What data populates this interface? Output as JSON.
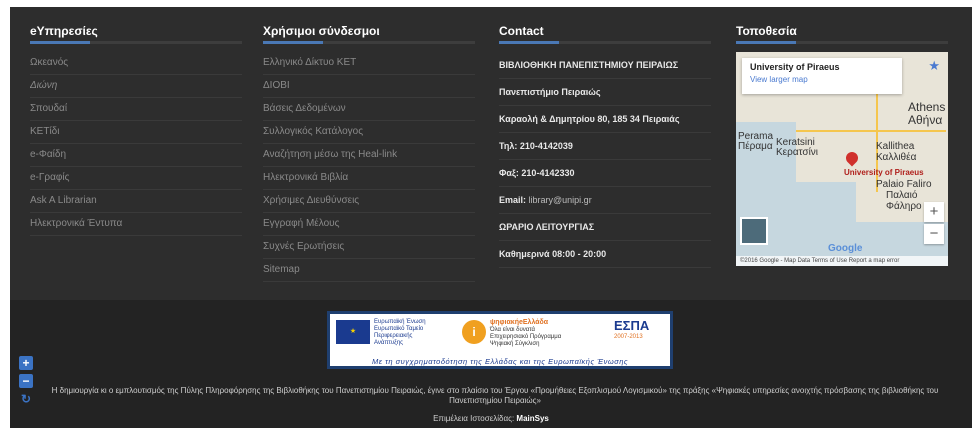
{
  "services": {
    "title": "eΥπηρεσίες",
    "items": [
      "Ωκεανός",
      "Διώνη",
      "Σπουδαί",
      "ΚΕΤίδι",
      "e-Φαίδη",
      "e-Γραφίς",
      "Ask A Librarian",
      "Ηλεκτρονικά Έντυπα"
    ]
  },
  "links": {
    "title": "Χρήσιμοι σύνδεσμοι",
    "items": [
      "Ελληνικό Δίκτυο ΚΕΤ",
      "ΔΙΟΒΙ",
      "Βάσεις Δεδομένων",
      "Συλλογικός Κατάλογος",
      "Αναζήτηση μέσω της Heal-link",
      "Ηλεκτρονικά Βιβλία",
      "Χρήσιμες Διευθύνσεις",
      "Εγγραφή Μέλους",
      "Συχνές Ερωτήσεις",
      "Sitemap"
    ]
  },
  "contact": {
    "title": "Contact",
    "library": "ΒΙΒΛΙΟΘΗΚΗ ΠΑΝΕΠΙΣΤΗΜΙΟΥ ΠΕΙΡΑΙΩΣ",
    "university": "Πανεπιστήμιο Πειραιώς",
    "address": "Καραολή & Δημητρίου 80, 185 34 Πειραιάς",
    "phone": "Τηλ: 210-4142039",
    "fax": "Φαξ: 210-4142330",
    "email_label": "Email:",
    "email_value": "library@unipi.gr",
    "hours_title": "ΩΡΑΡΙΟ ΛΕΙΤΟΥΡΓΙΑΣ",
    "hours": "Καθημερινά 08:00 - 20:00"
  },
  "location": {
    "title": "Τοποθεσία",
    "place_name": "University of Piraeus",
    "larger_map": "View larger map",
    "pin_label": "University of Piraeus",
    "labels": [
      "Athens",
      "Αθήνα",
      "Perama",
      "Πέραμα",
      "Keratsini",
      "Κερατσίνι",
      "Kallithea",
      "Καλλιθέα",
      "Palaio Faliro",
      "Παλαιό",
      "Φάληρο"
    ],
    "zoom_in": "+",
    "zoom_out": "−",
    "google": "Google",
    "attribution": "©2016 Google - Map Data  Terms of Use  Report a map error"
  },
  "banner": {
    "eu_title": "Ευρωπαϊκή Ένωση",
    "eu_sub": "Ευρωπαϊκό Ταμείο Περιφερειακής Ανάπτυξης",
    "digital_title": "ψηφιακήeΕλλάδα",
    "digital_sub": "Όλα είναι δυνατά",
    "digital_note": "Επιχειρησιακό Πρόγραμμα Ψηφιακή Σύγκλιση",
    "espa": "ΕΣΠΑ",
    "espa_years": "2007-2013",
    "caption": "Με τη συγχρηματοδότηση της Ελλάδας και της Ευρωπαϊκής Ένωσης"
  },
  "footer": {
    "note": "Η δημιουργία κι ο εμπλουτισμός της Πύλης Πληροφόρησης της Βιβλιοθήκης του Πανεπιστημίου Πειραιώς, έγινε στο πλαίσιο του Έργου «Προμήθειες Εξοπλισμού Λογισμικού» της πράξης «Ψηφιακές υπηρεσίες ανοιχτής πρόσβασης της βιβλιοθήκης του Πανεπιστημίου Πειραιώς»",
    "credit_label": "Επιμέλεια Ιστοσελίδας:",
    "credit_name": "MainSys"
  },
  "accessibility": {
    "increase": "+",
    "decrease": "−",
    "reset": "↻"
  }
}
